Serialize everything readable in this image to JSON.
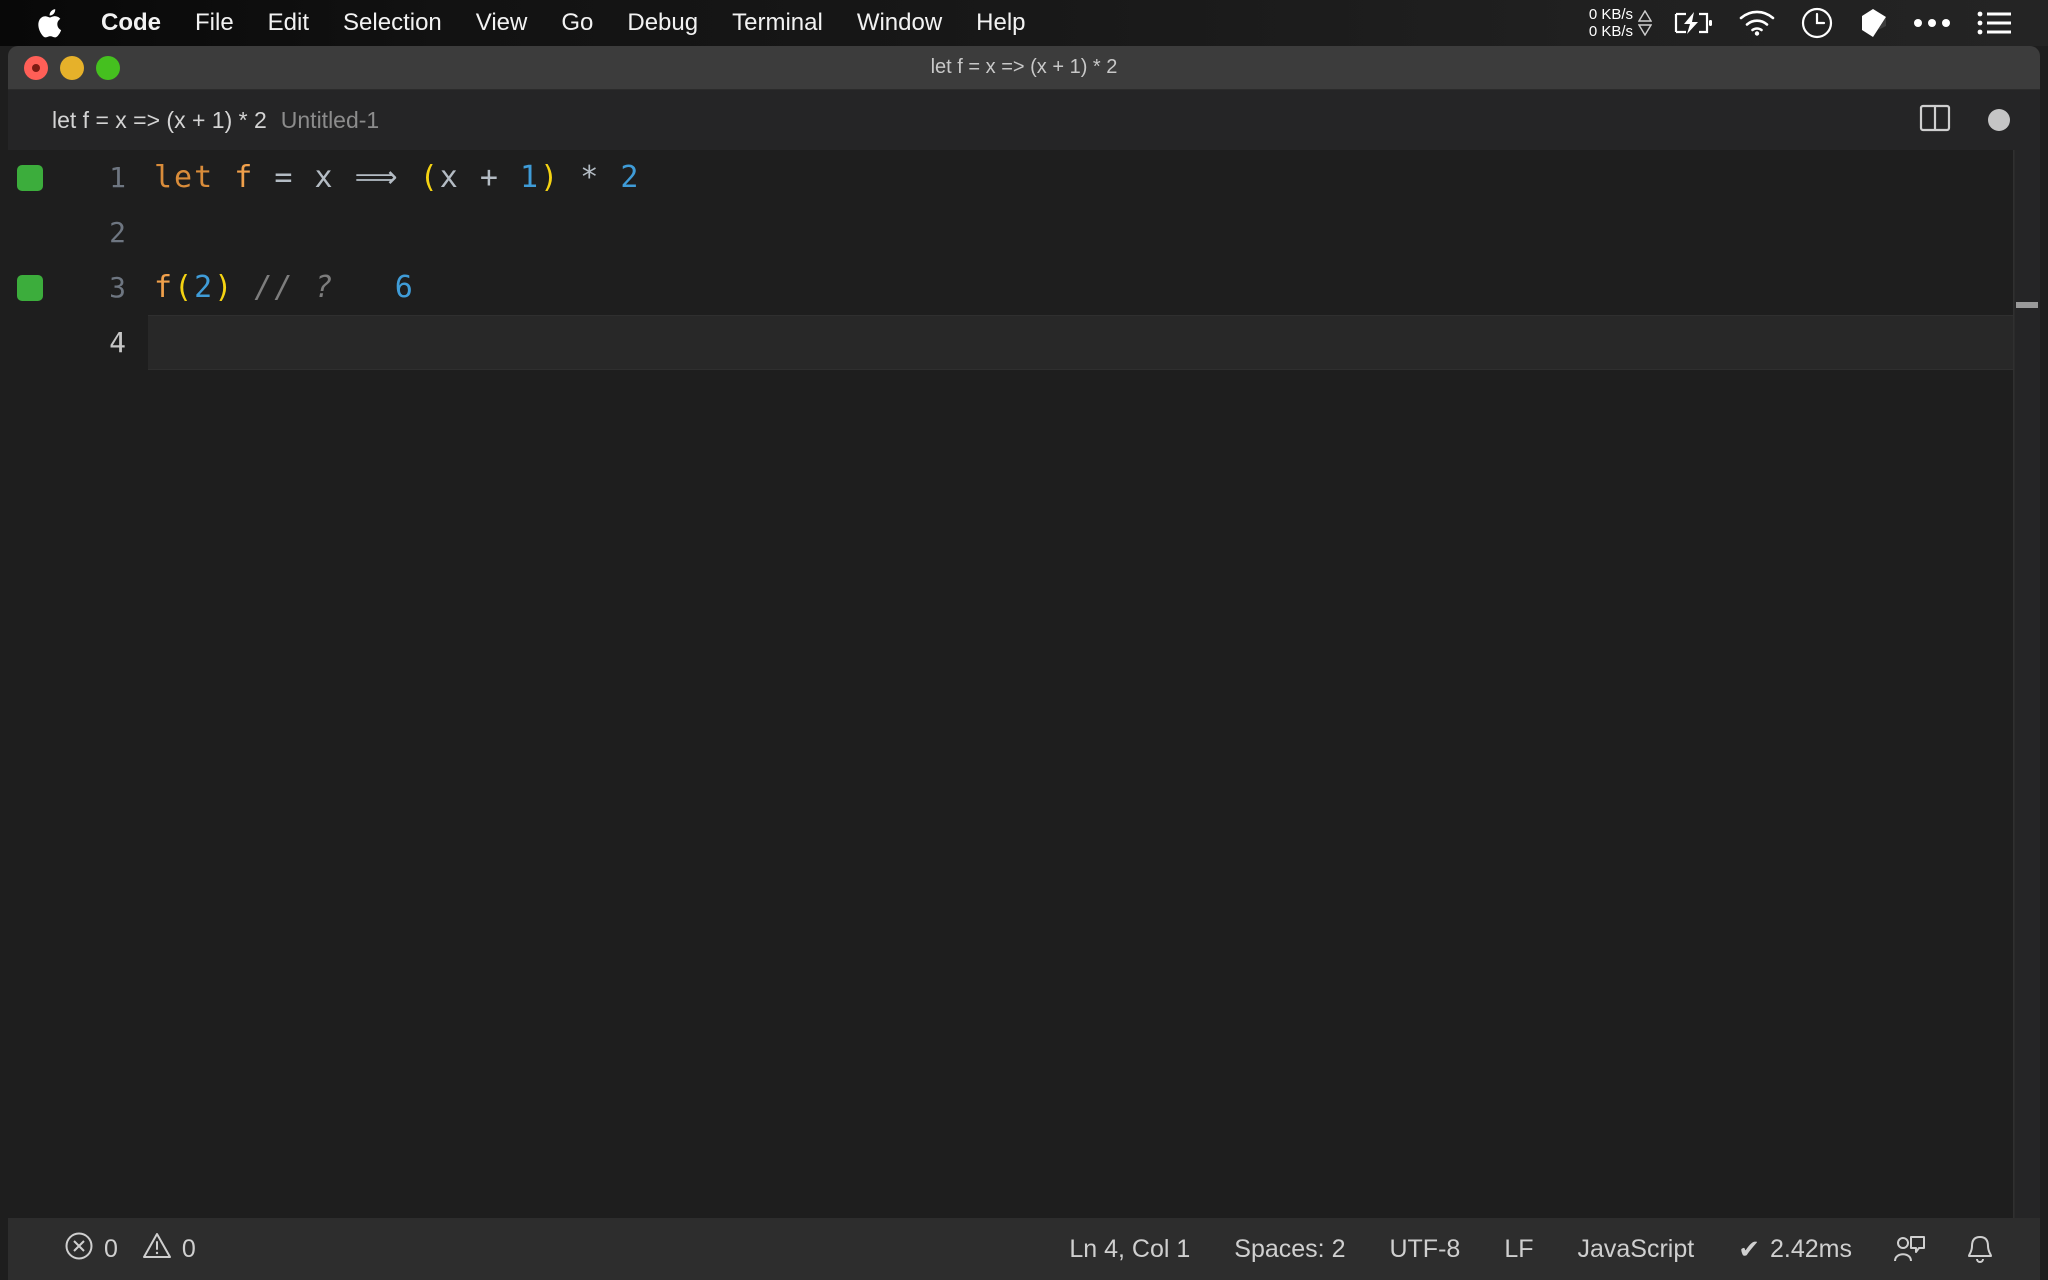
{
  "menubar": {
    "apple_icon": "apple-logo-icon",
    "items": [
      {
        "label": "Code",
        "bold": true
      },
      {
        "label": "File",
        "bold": false
      },
      {
        "label": "Edit",
        "bold": false
      },
      {
        "label": "Selection",
        "bold": false
      },
      {
        "label": "View",
        "bold": false
      },
      {
        "label": "Go",
        "bold": false
      },
      {
        "label": "Debug",
        "bold": false
      },
      {
        "label": "Terminal",
        "bold": false
      },
      {
        "label": "Window",
        "bold": false
      },
      {
        "label": "Help",
        "bold": false
      }
    ],
    "network": {
      "up": "0 KB/s",
      "down": "0 KB/s"
    },
    "icons": [
      "battery-charging-icon",
      "wifi-icon",
      "clock-icon",
      "dropbox-icon",
      "ellipsis-icon",
      "list-menu-icon"
    ]
  },
  "window": {
    "title": "let f = x => (x + 1) * 2",
    "traffic_lights": [
      "close-button",
      "minimize-button",
      "maximize-button"
    ]
  },
  "breadcrumbs": {
    "primary": "let f = x => (x + 1) * 2",
    "secondary": "Untitled-1",
    "actions": [
      "split-editor-icon",
      "unsaved-dot-indicator"
    ]
  },
  "editor": {
    "lines": [
      {
        "number": "1",
        "marker": true,
        "active": false,
        "tokens": [
          {
            "text": "let",
            "type": "kw"
          },
          {
            "text": " ",
            "type": "op"
          },
          {
            "text": "f",
            "type": "fn"
          },
          {
            "text": " ",
            "type": "op"
          },
          {
            "text": "=",
            "type": "op"
          },
          {
            "text": " ",
            "type": "op"
          },
          {
            "text": "x",
            "type": "var"
          },
          {
            "text": " ",
            "type": "op"
          },
          {
            "text": "⟹",
            "type": "op"
          },
          {
            "text": " ",
            "type": "op"
          },
          {
            "text": "(",
            "type": "paren"
          },
          {
            "text": "x",
            "type": "var"
          },
          {
            "text": " + ",
            "type": "op"
          },
          {
            "text": "1",
            "type": "num"
          },
          {
            "text": ")",
            "type": "paren"
          },
          {
            "text": " ",
            "type": "op"
          },
          {
            "text": "*",
            "type": "op"
          },
          {
            "text": " ",
            "type": "op"
          },
          {
            "text": "2",
            "type": "num"
          }
        ]
      },
      {
        "number": "2",
        "marker": false,
        "active": false,
        "tokens": []
      },
      {
        "number": "3",
        "marker": true,
        "active": false,
        "tokens": [
          {
            "text": "f",
            "type": "fn"
          },
          {
            "text": "(",
            "type": "paren"
          },
          {
            "text": "2",
            "type": "num"
          },
          {
            "text": ")",
            "type": "paren"
          },
          {
            "text": " ",
            "type": "op"
          },
          {
            "text": "//",
            "type": "comment"
          },
          {
            "text": " ",
            "type": "op"
          },
          {
            "text": "?",
            "type": "comment"
          },
          {
            "text": "   ",
            "type": "op"
          },
          {
            "text": "6",
            "type": "value"
          }
        ]
      },
      {
        "number": "4",
        "marker": false,
        "active": true,
        "tokens": []
      }
    ]
  },
  "statusbar": {
    "errors": "0",
    "warnings": "0",
    "error_icon": "error-circle-icon",
    "warning_icon": "warning-triangle-icon",
    "cursor_position": "Ln 4, Col 1",
    "indentation": "Spaces: 2",
    "encoding": "UTF-8",
    "line_ending": "LF",
    "language": "JavaScript",
    "run_time": "2.42ms",
    "run_check": "✔",
    "feedback_icon": "feedback-person-icon",
    "bell_icon": "notifications-bell-icon"
  },
  "colors": {
    "editor_bg": "#1e1e1e",
    "titlebar_bg": "#3c3c3c",
    "statusbar_bg": "#2d2d2d",
    "marker_green": "#3cad3c",
    "paren_yellow": "#f5d312",
    "number_blue": "#3f9cd8",
    "keyword_orange": "#d98c3a"
  }
}
